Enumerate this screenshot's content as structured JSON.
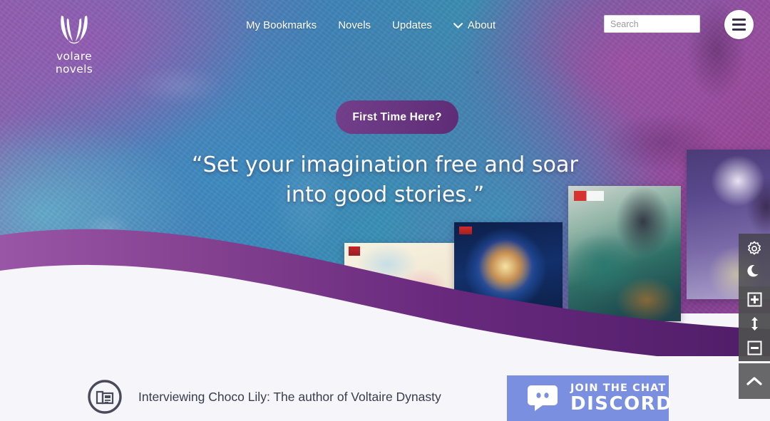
{
  "site": {
    "logo_text": "volare novels",
    "logo_icon": "wing-flame-logo"
  },
  "nav": {
    "links": [
      {
        "label": "My Bookmarks",
        "icon": null
      },
      {
        "label": "Novels",
        "icon": null
      },
      {
        "label": "Updates",
        "icon": null
      },
      {
        "label": "About",
        "icon": "chevron-down-icon"
      }
    ],
    "search": {
      "value": "",
      "placeholder": "Search",
      "icon": "search-field"
    },
    "menu_button": "hamburger-icon"
  },
  "hero": {
    "cta_label": "First Time Here?",
    "tagline": "“Set your imagination free and soar into good stories.”",
    "tagline_line1": "“Set your imagination free and soar",
    "tagline_line2": "into good stories.”",
    "covers": [
      {
        "name": "novel-cover-1",
        "alt": "pale classical illustration cover"
      },
      {
        "name": "novel-cover-2",
        "alt": "blue cosmic sphere cover"
      },
      {
        "name": "novel-cover-3",
        "alt": "green robed figure cover"
      },
      {
        "name": "novel-cover-4",
        "alt": "purple lady with parasol cover"
      }
    ]
  },
  "news": {
    "icon": "newspaper-icon",
    "title": "Interviewing Choco Lily: The author of Voltaire Dynasty"
  },
  "discord": {
    "icon": "discord-logo-icon",
    "line1": "JOIN THE CHAT",
    "line2": "DISCORD"
  },
  "tool_rail": {
    "buttons": [
      {
        "name": "settings-gear-icon",
        "label": "Settings"
      },
      {
        "name": "moon-icon",
        "label": "Night mode"
      },
      {
        "name": "increase-font-icon",
        "label": "Increase font size"
      },
      {
        "name": "line-height-icon",
        "label": "Line height"
      },
      {
        "name": "decrease-font-icon",
        "label": "Decrease font size"
      },
      {
        "name": "scroll-to-top-icon",
        "label": "Back to top"
      }
    ]
  },
  "colors": {
    "brand_purple": "#5b2472",
    "wave_light": "#8e4a99",
    "wave_dark": "#5b2472",
    "discord_blue": "#7b8fe0",
    "page_bg": "#f5f5fa",
    "text_dark": "#3b3b4d"
  }
}
